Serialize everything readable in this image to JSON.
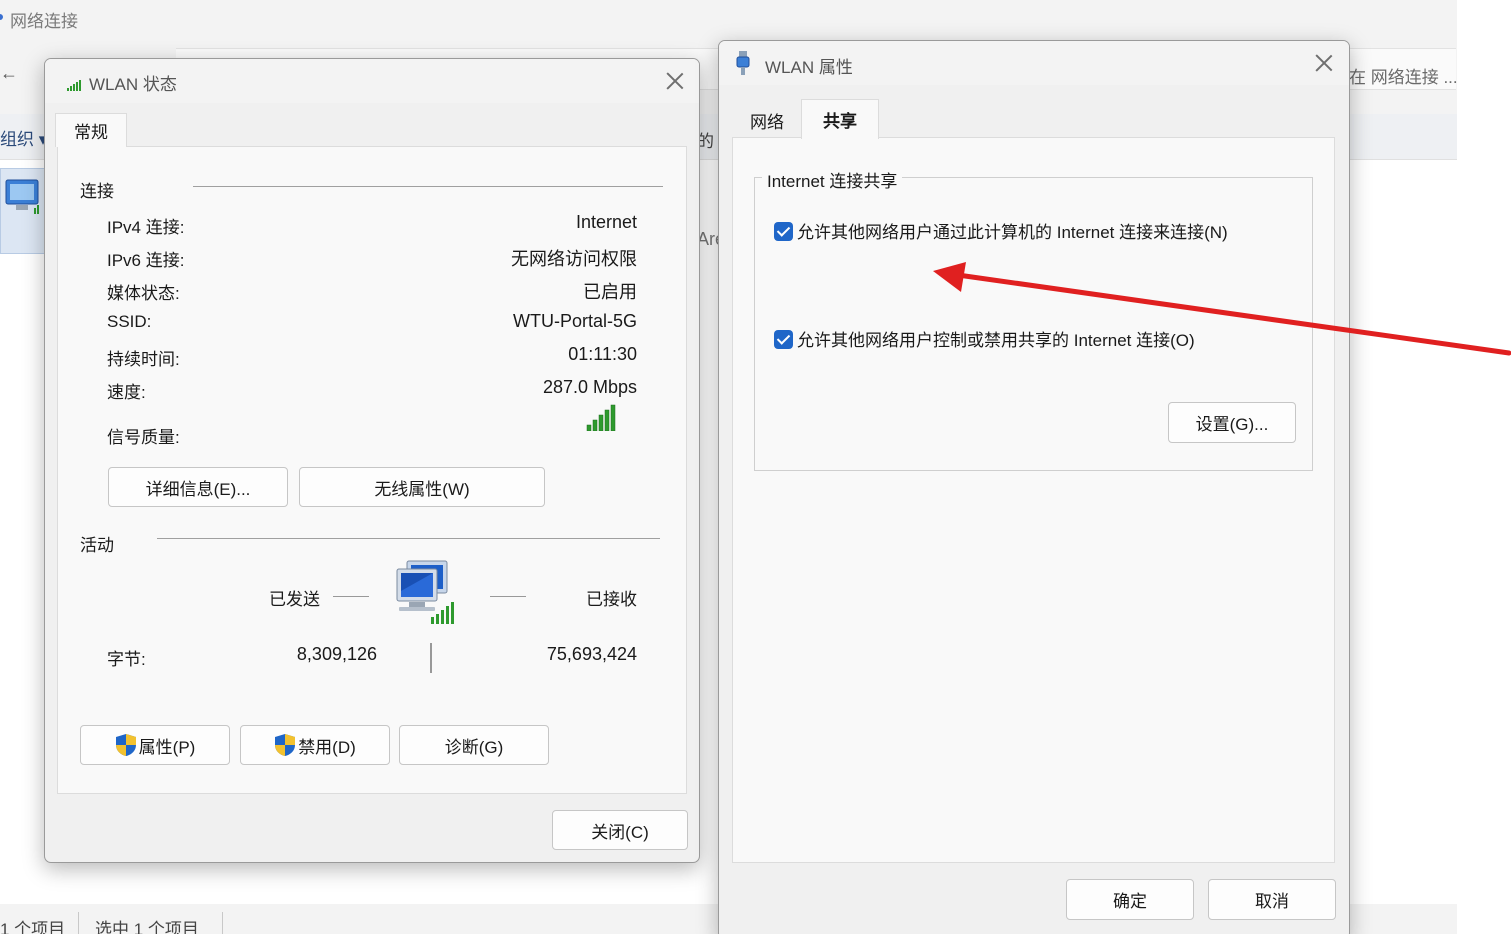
{
  "background_window": {
    "title": "网络连接",
    "back_arrow": "←",
    "search_text": "在 网络连接 ...",
    "organize_label": "组织 ▾",
    "partial_text_are": "Are",
    "partial_text_de": "的",
    "status_item_count": "1 个项目",
    "status_selected": "选中 1 个项目"
  },
  "status_dialog": {
    "title": "WLAN 状态",
    "tab_general": "常规",
    "section_connection": "连接",
    "rows": [
      {
        "label": "IPv4 连接:",
        "value": "Internet"
      },
      {
        "label": "IPv6 连接:",
        "value": "无网络访问权限"
      },
      {
        "label": "媒体状态:",
        "value": "已启用"
      },
      {
        "label": "SSID:",
        "value": "WTU-Portal-5G"
      },
      {
        "label": "持续时间:",
        "value": "01:11:30"
      },
      {
        "label": "速度:",
        "value": "287.0 Mbps"
      }
    ],
    "signal_label": "信号质量:",
    "signal_bars_filled": 5,
    "signal_bars_total": 5,
    "details_button": "详细信息(E)...",
    "wireless_props_button": "无线属性(W)",
    "section_activity": "活动",
    "sent_label": "已发送",
    "received_label": "已接收",
    "bytes_label": "字节:",
    "bytes_sent": "8,309,126",
    "bytes_received": "75,693,424",
    "properties_button": "属性(P)",
    "disable_button": "禁用(D)",
    "diagnose_button": "诊断(G)",
    "close_button": "关闭(C)"
  },
  "props_dialog": {
    "title": "WLAN 属性",
    "tab_network": "网络",
    "tab_sharing": "共享",
    "group_title": "Internet 连接共享",
    "checkbox1_label": "允许其他网络用户通过此计算机的 Internet 连接来连接(N)",
    "checkbox1_checked": true,
    "checkbox2_label": "允许其他网络用户控制或禁用共享的 Internet 连接(O)",
    "checkbox2_checked": true,
    "settings_button": "设置(G)...",
    "ok_button": "确定",
    "cancel_button": "取消"
  },
  "colors": {
    "accent_blue": "#1f66c8",
    "annotation_red": "#e02020",
    "signal_green": "#2e9a2e"
  }
}
